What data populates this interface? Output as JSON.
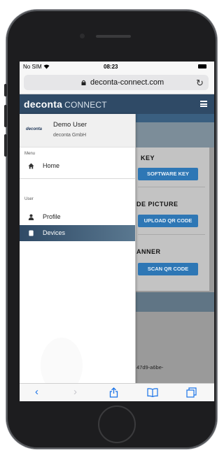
{
  "status_bar": {
    "carrier": "No SIM",
    "time": "08:23"
  },
  "browser": {
    "url": "deconta-connect.com"
  },
  "app": {
    "brand": "deconta",
    "brand_suffix": "CONNECT"
  },
  "drawer": {
    "logo_text": "deconta",
    "user_name": "Demo User",
    "user_company": "deconta GmbH",
    "menu_section": "Menu",
    "menu_items": [
      {
        "label": "Home",
        "icon": "home-icon"
      }
    ],
    "user_section": "User",
    "user_items": [
      {
        "label": "Profile",
        "icon": "person-icon"
      },
      {
        "label": "Devices",
        "icon": "device-icon",
        "active": true
      }
    ]
  },
  "background_page": {
    "section1_label": "KEY",
    "section1_button": "SOFTWARE KEY",
    "section2_label": "DE PICTURE",
    "section2_button": "UPLOAD QR CODE",
    "section3_label": "ANNER",
    "section3_button": "SCAN QR CODE",
    "footer_fragment": "47d9-a6be-"
  },
  "colors": {
    "appbar": "#2f4a66",
    "button": "#2e77b5",
    "safari_blue": "#1a73e8"
  }
}
